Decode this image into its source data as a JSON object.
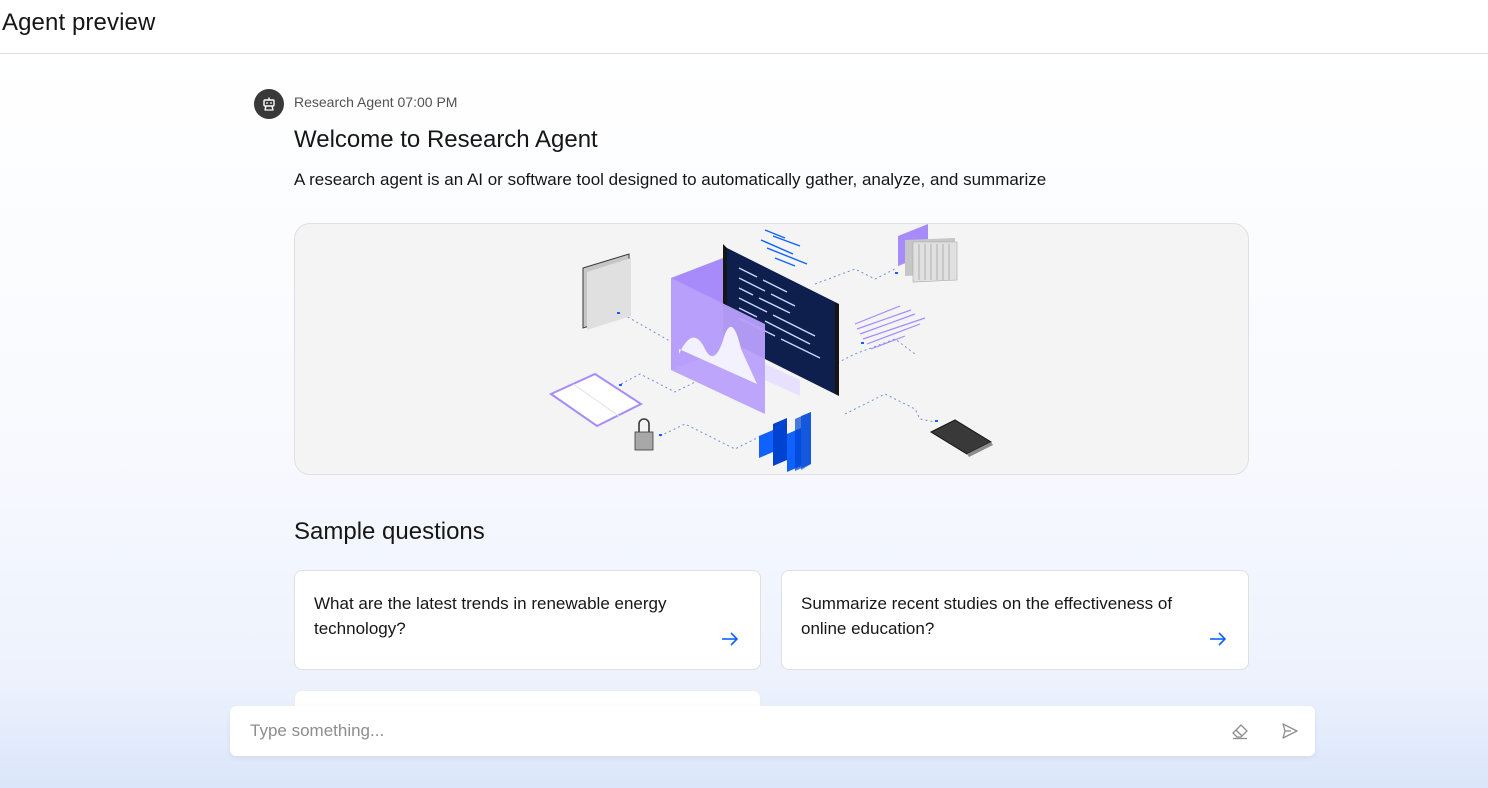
{
  "header": {
    "title": "Agent preview"
  },
  "message": {
    "avatar_icon": "robot-icon",
    "sender": "Research Agent",
    "time": "07:00 PM",
    "welcome_title": "Welcome to Research Agent",
    "description": "A research agent is an AI or software tool designed to automatically gather, analyze, and summarize",
    "illustration": "research-illustration"
  },
  "samples": {
    "title": "Sample questions",
    "questions": [
      {
        "text": "What are the latest trends in renewable energy technology?",
        "icon": "arrow-right-icon"
      },
      {
        "text": "Summarize recent studies on the effectiveness of online education?",
        "icon": "arrow-right-icon"
      }
    ]
  },
  "input": {
    "placeholder": "Type something...",
    "value": "",
    "clear_icon": "eraser-icon",
    "send_icon": "send-icon"
  },
  "colors": {
    "accent": "#0f62fe",
    "purple": "#a78bfa",
    "avatar_bg": "#393939"
  }
}
